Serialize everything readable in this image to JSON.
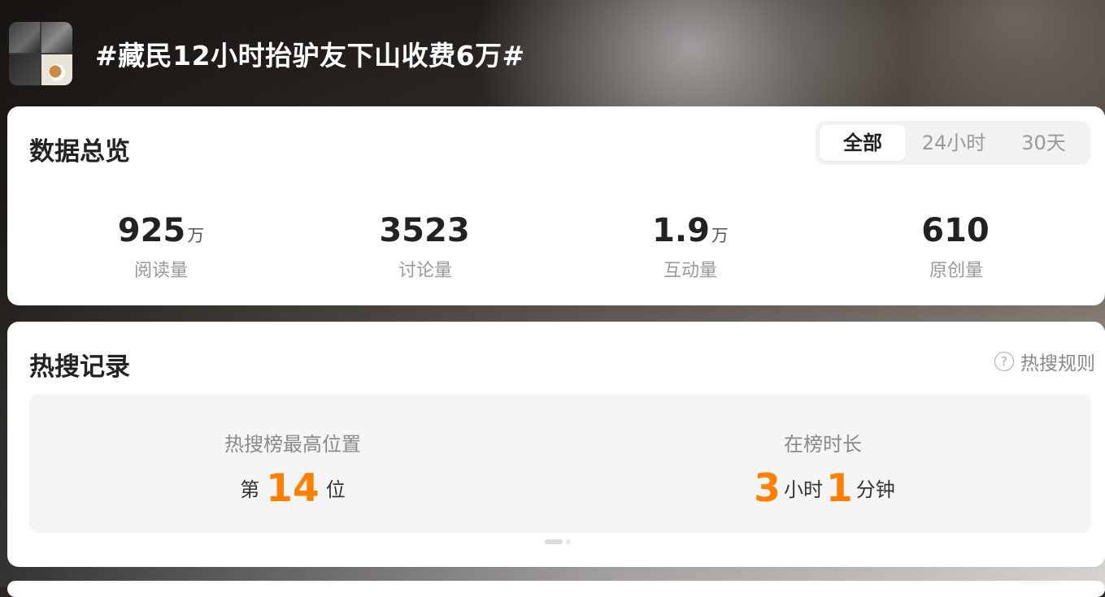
{
  "header": {
    "title": "#藏民12小时抬驴友下山收费6万#"
  },
  "overview": {
    "title": "数据总览",
    "tabs": [
      {
        "label": "全部",
        "active": true
      },
      {
        "label": "24小时",
        "active": false
      },
      {
        "label": "30天",
        "active": false
      }
    ],
    "stats": [
      {
        "value": "925",
        "unit": "万",
        "label": "阅读量"
      },
      {
        "value": "3523",
        "unit": "",
        "label": "讨论量"
      },
      {
        "value": "1.9",
        "unit": "万",
        "label": "互动量"
      },
      {
        "value": "610",
        "unit": "",
        "label": "原创量"
      }
    ]
  },
  "hot_search": {
    "title": "热搜记录",
    "rule_link": "热搜规则",
    "rule_icon": "question-circle-icon",
    "highest_position": {
      "label": "热搜榜最高位置",
      "prefix": "第",
      "value": "14",
      "suffix": "位"
    },
    "duration": {
      "label": "在榜时长",
      "hours": "3",
      "hours_unit": "小时",
      "minutes": "1",
      "minutes_unit": "分钟"
    }
  },
  "colors": {
    "accent": "#ff7f00",
    "text_primary": "#222222",
    "text_secondary": "#999999",
    "card_bg": "#ffffff",
    "panel_bg": "#f5f5f5"
  }
}
